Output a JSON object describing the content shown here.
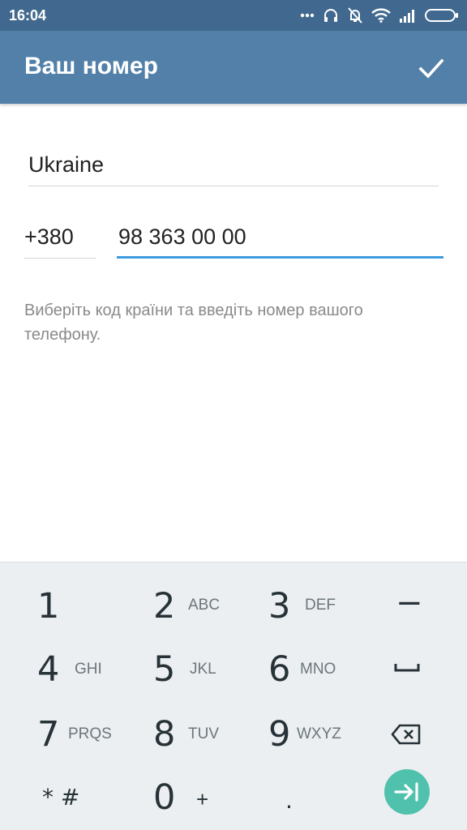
{
  "status_bar": {
    "time": "16:04",
    "icons": [
      "more-dots-icon",
      "headphones-icon",
      "bell-off-icon",
      "wifi-icon",
      "signal-icon",
      "battery-icon"
    ]
  },
  "app_bar": {
    "title": "Ваш номер",
    "done_icon": "check-icon",
    "background": "#5280a8"
  },
  "form": {
    "country": "Ukraine",
    "country_code": "+380",
    "phone_number": "98 363 00 00",
    "hint": "Виберіть код країни та введіть номер вашого телефону."
  },
  "keypad": {
    "keys": [
      {
        "digit": "1",
        "letters": ""
      },
      {
        "digit": "2",
        "letters": "ABC"
      },
      {
        "digit": "3",
        "letters": "DEF"
      },
      {
        "digit": "4",
        "letters": "GHI"
      },
      {
        "digit": "5",
        "letters": "JKL"
      },
      {
        "digit": "6",
        "letters": "MNO"
      },
      {
        "digit": "7",
        "letters": "PRQS"
      },
      {
        "digit": "8",
        "letters": "TUV"
      },
      {
        "digit": "9",
        "letters": "WXYZ"
      },
      {
        "digit": "0",
        "letters": "+"
      }
    ],
    "symbols": {
      "star_hash": "* #",
      "dash": "−",
      "dot": ".",
      "space_icon": "space-icon",
      "backspace_icon": "backspace-icon",
      "next_icon": "next-arrow-icon"
    },
    "accent": "#4fc1ad"
  }
}
